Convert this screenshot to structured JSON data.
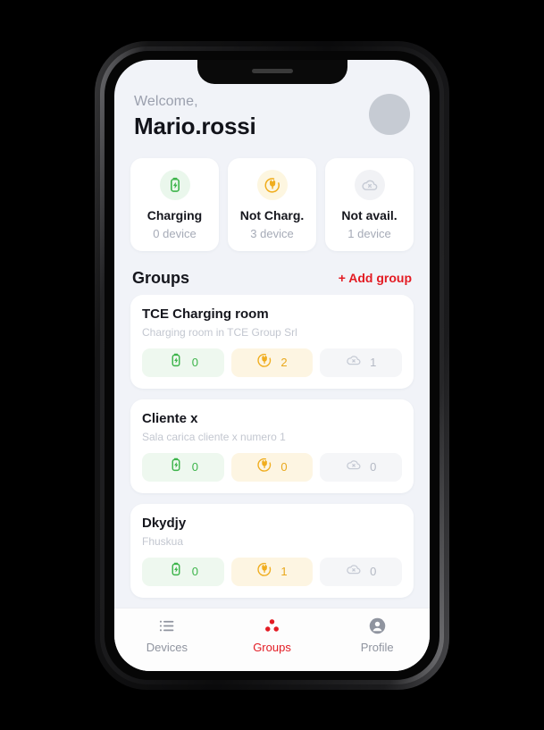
{
  "header": {
    "welcome_label": "Welcome,",
    "user_name": "Mario.rossi",
    "avatar_icon": "avatar-circle"
  },
  "stats": [
    {
      "icon": "battery-charging-icon",
      "title": "Charging",
      "subtitle": "0 device",
      "tone": "green",
      "color": "#3cb44a"
    },
    {
      "icon": "plug-icon",
      "title": "Not Charg.",
      "subtitle": "3 device",
      "tone": "amber",
      "color": "#f0ad1e"
    },
    {
      "icon": "cloud-off-icon",
      "title": "Not avail.",
      "subtitle": "1 device",
      "tone": "gray",
      "color": "#c6cbd5"
    }
  ],
  "groups_section": {
    "title": "Groups",
    "add_button_label": "+ Add group",
    "add_button_color": "#e31b23"
  },
  "groups": [
    {
      "name": "TCE Charging room",
      "description": "Charging room in TCE Group Srl",
      "chips": [
        {
          "icon": "battery-charging-icon",
          "count": "0",
          "tone": "green"
        },
        {
          "icon": "plug-icon",
          "count": "2",
          "tone": "amber"
        },
        {
          "icon": "cloud-off-icon",
          "count": "1",
          "tone": "gray"
        }
      ]
    },
    {
      "name": "Cliente x",
      "description": "Sala carica cliente x numero 1",
      "chips": [
        {
          "icon": "battery-charging-icon",
          "count": "0",
          "tone": "green"
        },
        {
          "icon": "plug-icon",
          "count": "0",
          "tone": "amber"
        },
        {
          "icon": "cloud-off-icon",
          "count": "0",
          "tone": "gray"
        }
      ]
    },
    {
      "name": "Dkydjy",
      "description": "Fhuskua",
      "chips": [
        {
          "icon": "battery-charging-icon",
          "count": "0",
          "tone": "green"
        },
        {
          "icon": "plug-icon",
          "count": "1",
          "tone": "amber"
        },
        {
          "icon": "cloud-off-icon",
          "count": "0",
          "tone": "gray"
        }
      ]
    }
  ],
  "tabs": [
    {
      "icon": "list-icon",
      "label": "Devices",
      "active": false
    },
    {
      "icon": "dots-triangle-icon",
      "label": "Groups",
      "active": true
    },
    {
      "icon": "person-icon",
      "label": "Profile",
      "active": false
    }
  ]
}
